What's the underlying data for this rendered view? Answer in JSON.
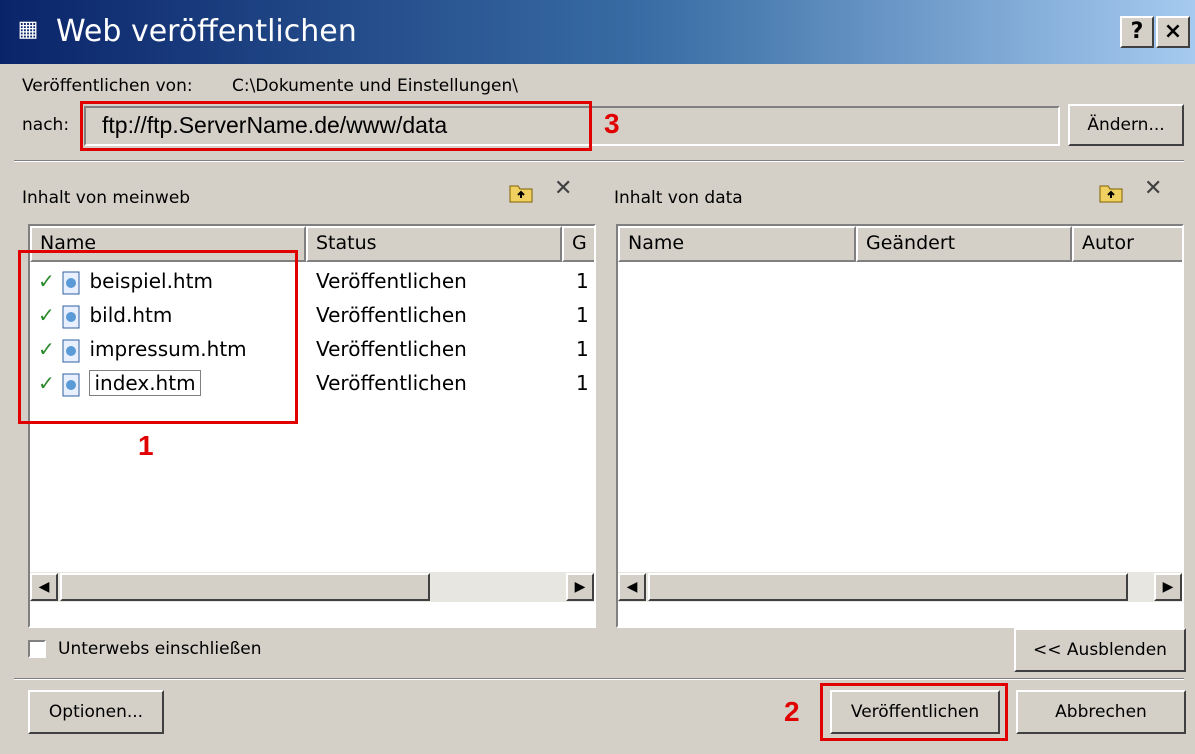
{
  "window": {
    "title": "Web veröffentlichen",
    "help_btn": "?",
    "close_btn": "×",
    "app_icon": "publish-web-icon"
  },
  "source": {
    "label": "Veröffentlichen von:",
    "path": "C:\\Dokumente und Einstellungen\\"
  },
  "target": {
    "label": "nach:",
    "url": "ftp://ftp.ServerName.de/www/data",
    "change_btn": "Ändern..."
  },
  "left_pane": {
    "title": "Inhalt von meinweb",
    "columns": [
      "Name",
      "Status",
      "G"
    ],
    "files": [
      {
        "name": "beispiel.htm",
        "status": "Veröffentlichen",
        "g": "1"
      },
      {
        "name": "bild.htm",
        "status": "Veröffentlichen",
        "g": "1"
      },
      {
        "name": "impressum.htm",
        "status": "Veröffentlichen",
        "g": "1"
      },
      {
        "name": "index.htm",
        "status": "Veröffentlichen",
        "g": "1"
      }
    ]
  },
  "right_pane": {
    "title": "Inhalt von data",
    "columns": [
      "Name",
      "Geändert",
      "Autor"
    ]
  },
  "subwebs": {
    "label": "Unterwebs einschließen",
    "checked": false
  },
  "hide_btn": "<< Ausblenden",
  "options_btn": "Optionen...",
  "publish_btn": "Veröffentlichen",
  "cancel_btn": "Abbrechen",
  "annotations": [
    "1",
    "2",
    "3"
  ],
  "colors": {
    "annotation": "#e00000",
    "titlebar": "#0a246a",
    "check": "#2a8a2a"
  }
}
